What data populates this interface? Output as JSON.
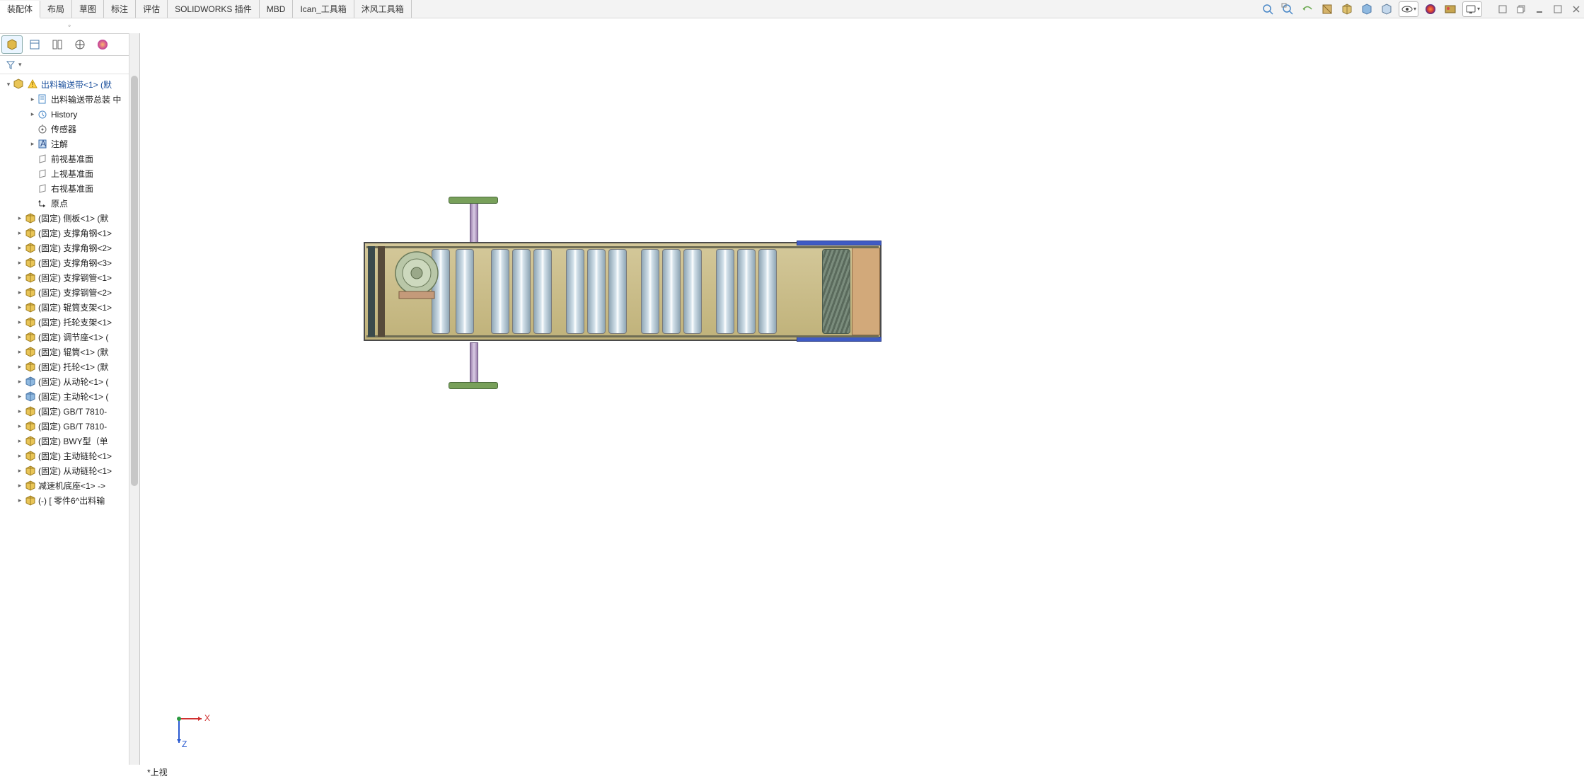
{
  "tabs": {
    "items": [
      "装配体",
      "布局",
      "草图",
      "标注",
      "评估",
      "SOLIDWORKS 插件",
      "MBD",
      "Ican_工具箱",
      "沐风工具箱"
    ]
  },
  "view_tools": [
    "zoom-fit",
    "zoom-area",
    "rotate",
    "section",
    "display-style",
    "scene",
    "draft-quality",
    "cube",
    "eye",
    "appearance-sphere",
    "appearance-cube",
    "screen"
  ],
  "window_controls": [
    "float-icon",
    "restore-icon",
    "minimize-icon",
    "maximize-icon",
    "close-icon"
  ],
  "right_bar": [
    {
      "name": "home-icon",
      "glyph": "⌂",
      "fg": "#2e6bd6"
    },
    {
      "name": "box-icon",
      "glyph": "▦",
      "fg": "#666"
    },
    {
      "name": "folder-icon",
      "glyph": "📁",
      "fg": "#d9a33a"
    },
    {
      "name": "grid-icon",
      "glyph": "▤",
      "fg": "#d04aa0"
    },
    {
      "name": "ball-icon",
      "glyph": "●",
      "fg": "#cc3b3b"
    },
    {
      "name": "list-icon",
      "glyph": "≣",
      "fg": "#3a9ad9"
    }
  ],
  "tree": {
    "root": "出料输送带<1> (默",
    "items": [
      {
        "lvl": 2,
        "caret": ">",
        "icon": "sheet",
        "label": "出料输送带总装 中"
      },
      {
        "lvl": 2,
        "caret": ">",
        "icon": "hist",
        "label": "History"
      },
      {
        "lvl": 2,
        "caret": "",
        "icon": "sensor",
        "label": "传感器"
      },
      {
        "lvl": 2,
        "caret": ">",
        "icon": "annot",
        "label": "注解"
      },
      {
        "lvl": 2,
        "caret": "",
        "icon": "plane",
        "label": "前视基准面"
      },
      {
        "lvl": 2,
        "caret": "",
        "icon": "plane",
        "label": "上视基准面"
      },
      {
        "lvl": 2,
        "caret": "",
        "icon": "plane",
        "label": "右视基准面"
      },
      {
        "lvl": 2,
        "caret": "",
        "icon": "origin",
        "label": "原点"
      },
      {
        "lvl": 1,
        "caret": ">",
        "icon": "asm",
        "label": "(固定) 侧板<1> (默"
      },
      {
        "lvl": 1,
        "caret": ">",
        "icon": "asm",
        "label": "(固定) 支撑角钢<1>"
      },
      {
        "lvl": 1,
        "caret": ">",
        "icon": "asm",
        "label": "(固定) 支撑角钢<2>"
      },
      {
        "lvl": 1,
        "caret": ">",
        "icon": "asm",
        "label": "(固定) 支撑角钢<3>"
      },
      {
        "lvl": 1,
        "caret": ">",
        "icon": "asm",
        "label": "(固定) 支撑钢管<1>"
      },
      {
        "lvl": 1,
        "caret": ">",
        "icon": "asm",
        "label": "(固定) 支撑钢管<2>"
      },
      {
        "lvl": 1,
        "caret": ">",
        "icon": "asm",
        "label": "(固定) 辊筒支架<1>"
      },
      {
        "lvl": 1,
        "caret": ">",
        "icon": "asm",
        "label": "(固定) 托轮支架<1>"
      },
      {
        "lvl": 1,
        "caret": ">",
        "icon": "asm",
        "label": "(固定) 调节座<1> ("
      },
      {
        "lvl": 1,
        "caret": ">",
        "icon": "asm",
        "label": "(固定) 辊筒<1> (默"
      },
      {
        "lvl": 1,
        "caret": ">",
        "icon": "asm",
        "label": "(固定) 托轮<1> (默"
      },
      {
        "lvl": 1,
        "caret": ">",
        "icon": "part",
        "label": "(固定) 从动轮<1> ("
      },
      {
        "lvl": 1,
        "caret": ">",
        "icon": "part",
        "label": "(固定) 主动轮<1> ("
      },
      {
        "lvl": 1,
        "caret": ">",
        "icon": "asm",
        "label": "(固定) GB/T 7810-"
      },
      {
        "lvl": 1,
        "caret": ">",
        "icon": "asm",
        "label": "(固定) GB/T 7810-"
      },
      {
        "lvl": 1,
        "caret": ">",
        "icon": "asm",
        "label": "(固定) BWY型（单"
      },
      {
        "lvl": 1,
        "caret": ">",
        "icon": "asm",
        "label": "(固定) 主动链轮<1>"
      },
      {
        "lvl": 1,
        "caret": ">",
        "icon": "asm",
        "label": "(固定) 从动链轮<1>"
      },
      {
        "lvl": 1,
        "caret": ">",
        "icon": "asm",
        "label": "减速机底座<1> ->"
      },
      {
        "lvl": 1,
        "caret": ">",
        "icon": "asm",
        "label": "(-) [ 零件6^出料输"
      }
    ]
  },
  "viewport": {
    "view_name": "*上视",
    "axes": {
      "x": "X",
      "z": "Z"
    }
  }
}
